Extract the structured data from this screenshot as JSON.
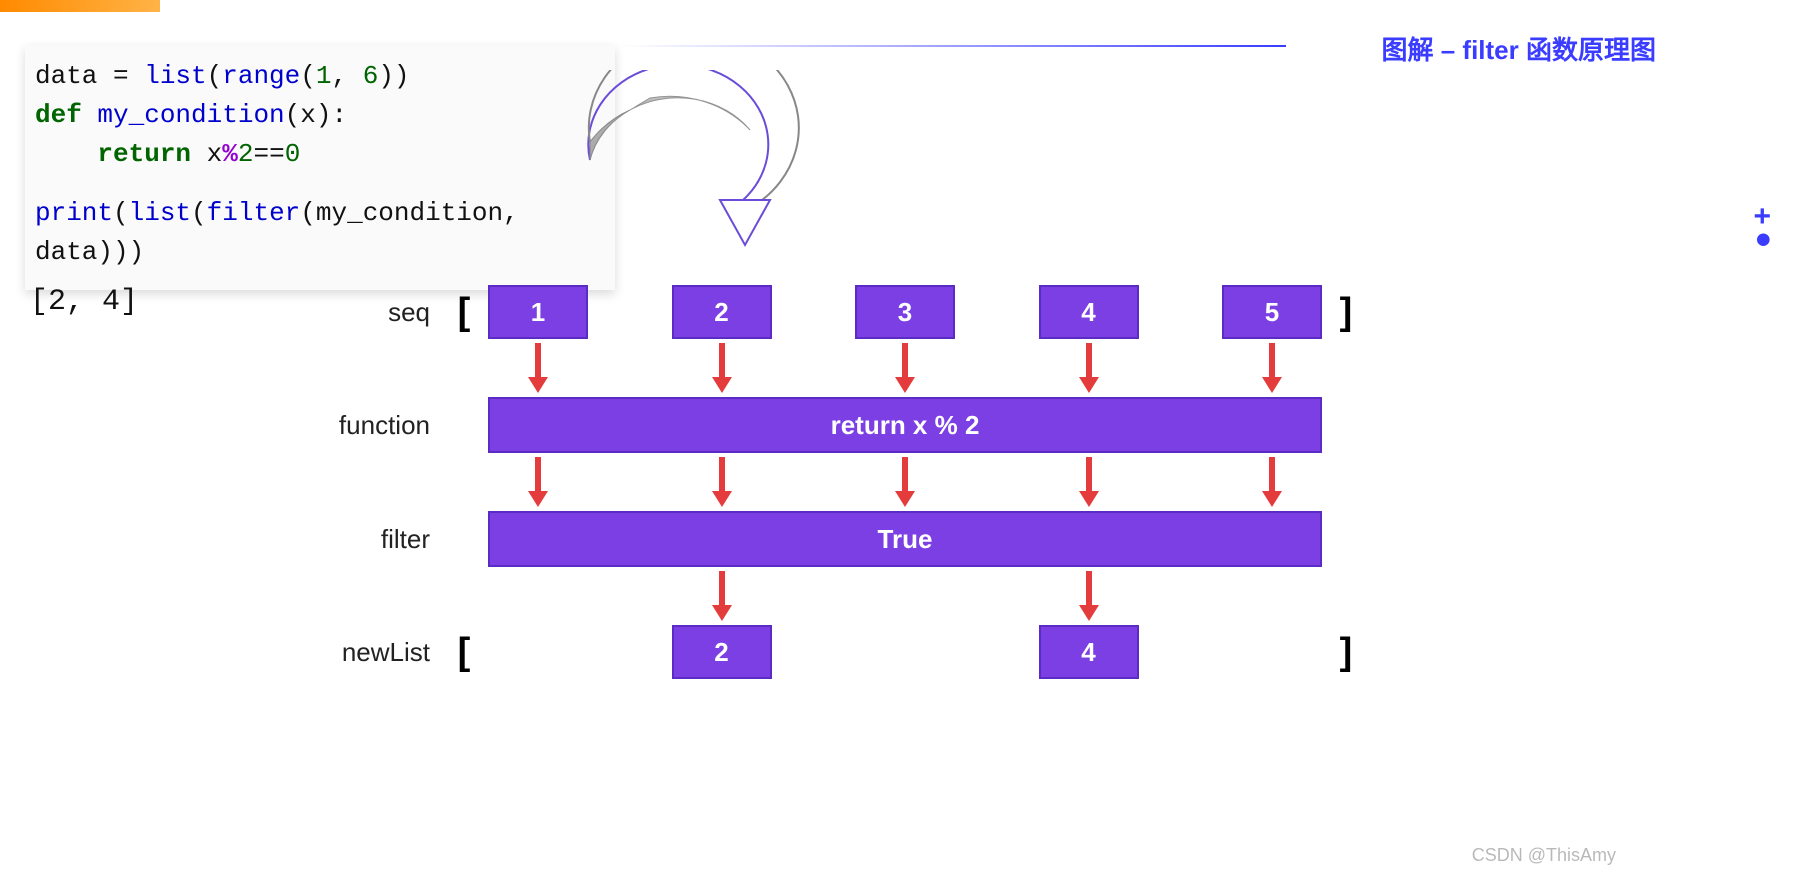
{
  "title": "图解 – filter 函数原理图",
  "code": {
    "line1_a": "data = ",
    "line1_list": "list",
    "line1_b": "(",
    "line1_range": "range",
    "line1_c": "(",
    "line1_num1": "1",
    "line1_d": ", ",
    "line1_num2": "6",
    "line1_e": "))",
    "line2_def": "def",
    "line2_fn": " my_condition",
    "line2_rest": "(x):",
    "line3_ret": "return",
    "line3_a": " x",
    "line3_op": "%",
    "line3_b": "2",
    "line3_c": "==",
    "line3_d": "0",
    "line4_a": "print",
    "line4_b": "(",
    "line4_list": "list",
    "line4_c": "(",
    "line4_filter": "filter",
    "line4_d": "(my_condition, data)))"
  },
  "output": "[2, 4]",
  "labels": {
    "seq": "seq",
    "function": "function",
    "filter": "filter",
    "newList": "newList"
  },
  "seq": [
    "1",
    "2",
    "3",
    "4",
    "5"
  ],
  "function_text": "return x % 2",
  "filter_text": "True",
  "newList": [
    "2",
    "4"
  ],
  "watermark": "CSDN @ThisAmy"
}
